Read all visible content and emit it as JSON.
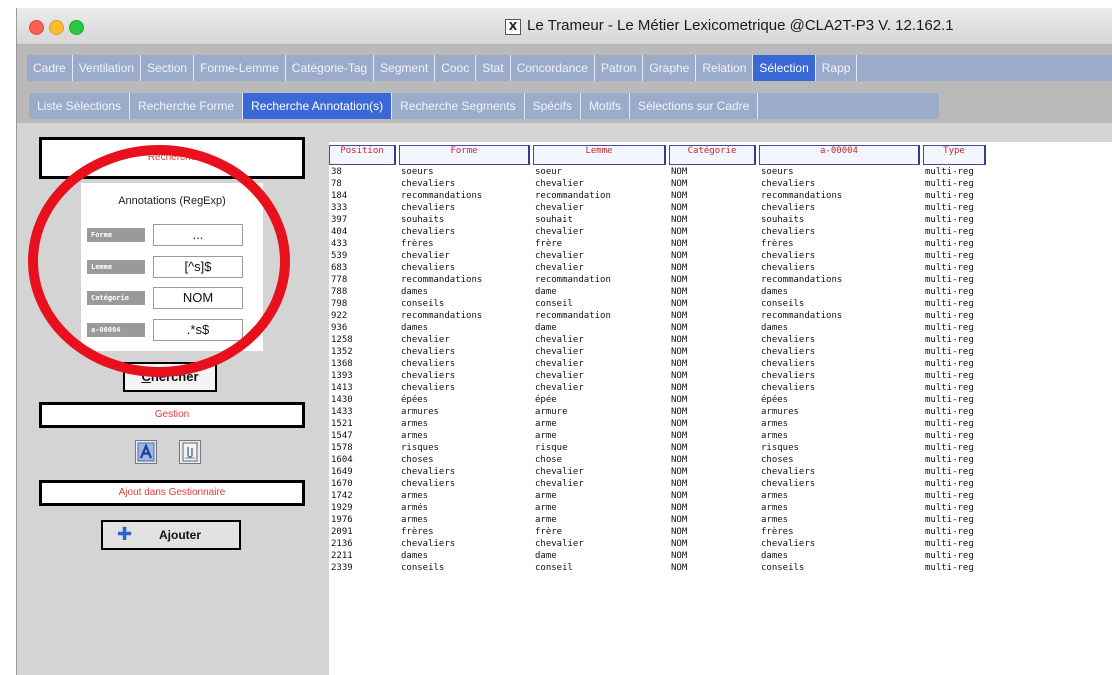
{
  "window": {
    "title_glyph": "X",
    "title": "Le Trameur - Le Métier Lexicometrique @CLA2T-P3 V. 12.162.1"
  },
  "main_tabs": [
    {
      "label": "Cadre"
    },
    {
      "label": "Ventilation"
    },
    {
      "label": "Section"
    },
    {
      "label": "Forme-Lemme"
    },
    {
      "label": "Catégorie-Tag"
    },
    {
      "label": "Segment"
    },
    {
      "label": "Cooc"
    },
    {
      "label": "Stat"
    },
    {
      "label": "Concordance"
    },
    {
      "label": "Patron"
    },
    {
      "label": "Graphe"
    },
    {
      "label": "Relation"
    },
    {
      "label": "Sélection",
      "active": true
    },
    {
      "label": "Rapp"
    }
  ],
  "sub_tabs": [
    {
      "label": "Liste Sélections"
    },
    {
      "label": "Recherche Forme"
    },
    {
      "label": "Recherche Annotation(s)",
      "active": true
    },
    {
      "label": "Recherche Segments"
    },
    {
      "label": "Spécifs"
    },
    {
      "label": "Motifs"
    },
    {
      "label": "Sélections sur Cadre"
    }
  ],
  "left_panel": {
    "recherche_title": "Recherche",
    "annotations_title": "Annotations (RegExp)",
    "fields": [
      {
        "label": "Forme",
        "value": "..."
      },
      {
        "label": "Lemme",
        "value": "[^s]$"
      },
      {
        "label": "Catégorie",
        "value": "NOM"
      },
      {
        "label": "a-00004",
        "value": ".*s$"
      }
    ],
    "chercher_accel": "C",
    "chercher_rest": "hercher",
    "gestion_title": "Gestion",
    "ajout_title": "Ajout dans Gestionnaire",
    "ajouter_label": "Ajouter"
  },
  "table": {
    "columns": [
      "Position",
      "Forme",
      "Lemme",
      "Catégorie",
      "a-00004",
      "Type",
      ""
    ],
    "rows": [
      [
        "38",
        "soeurs",
        "soeur",
        "NOM",
        "soeurs",
        "multi-reg"
      ],
      [
        "78",
        "chevaliers",
        "chevalier",
        "NOM",
        "chevaliers",
        "multi-reg"
      ],
      [
        "184",
        "recommandations",
        "recommandation",
        "NOM",
        "recommandations",
        "multi-reg"
      ],
      [
        "333",
        "chevaliers",
        "chevalier",
        "NOM",
        "chevaliers",
        "multi-reg"
      ],
      [
        "397",
        "souhaits",
        "souhait",
        "NOM",
        "souhaits",
        "multi-reg"
      ],
      [
        "404",
        "chevaliers",
        "chevalier",
        "NOM",
        "chevaliers",
        "multi-reg"
      ],
      [
        "433",
        "frères",
        "frère",
        "NOM",
        "frères",
        "multi-reg"
      ],
      [
        "539",
        "chevalier",
        "chevalier",
        "NOM",
        "chevaliers",
        "multi-reg"
      ],
      [
        "683",
        "chevaliers",
        "chevalier",
        "NOM",
        "chevaliers",
        "multi-reg"
      ],
      [
        "778",
        "recommandations",
        "recommandation",
        "NOM",
        "recommandations",
        "multi-reg"
      ],
      [
        "788",
        "dames",
        "dame",
        "NOM",
        "dames",
        "multi-reg"
      ],
      [
        "798",
        "conseils",
        "conseil",
        "NOM",
        "conseils",
        "multi-reg"
      ],
      [
        "922",
        "recommandations",
        "recommandation",
        "NOM",
        "recommandations",
        "multi-reg"
      ],
      [
        "936",
        "dames",
        "dame",
        "NOM",
        "dames",
        "multi-reg"
      ],
      [
        "1258",
        "chevalier",
        "chevalier",
        "NOM",
        "chevaliers",
        "multi-reg"
      ],
      [
        "1352",
        "chevaliers",
        "chevalier",
        "NOM",
        "chevaliers",
        "multi-reg"
      ],
      [
        "1368",
        "chevaliers",
        "chevalier",
        "NOM",
        "chevaliers",
        "multi-reg"
      ],
      [
        "1393",
        "chevaliers",
        "chevalier",
        "NOM",
        "chevaliers",
        "multi-reg"
      ],
      [
        "1413",
        "chevaliers",
        "chevalier",
        "NOM",
        "chevaliers",
        "multi-reg"
      ],
      [
        "1430",
        "épées",
        "épée",
        "NOM",
        "épées",
        "multi-reg"
      ],
      [
        "1433",
        "armures",
        "armure",
        "NOM",
        "armures",
        "multi-reg"
      ],
      [
        "1521",
        "armes",
        "arme",
        "NOM",
        "armes",
        "multi-reg"
      ],
      [
        "1547",
        "armes",
        "arme",
        "NOM",
        "armes",
        "multi-reg"
      ],
      [
        "1578",
        "risques",
        "risque",
        "NOM",
        "risques",
        "multi-reg"
      ],
      [
        "1604",
        "choses",
        "chose",
        "NOM",
        "choses",
        "multi-reg"
      ],
      [
        "1649",
        "chevaliers",
        "chevalier",
        "NOM",
        "chevaliers",
        "multi-reg"
      ],
      [
        "1670",
        "chevaliers",
        "chevalier",
        "NOM",
        "chevaliers",
        "multi-reg"
      ],
      [
        "1742",
        "armes",
        "arme",
        "NOM",
        "armes",
        "multi-reg"
      ],
      [
        "1929",
        "armés",
        "arme",
        "NOM",
        "armes",
        "multi-reg"
      ],
      [
        "1976",
        "armes",
        "arme",
        "NOM",
        "armes",
        "multi-reg"
      ],
      [
        "2091",
        "frères",
        "frère",
        "NOM",
        "frères",
        "multi-reg"
      ],
      [
        "2136",
        "chevaliers",
        "chevalier",
        "NOM",
        "chevaliers",
        "multi-reg"
      ],
      [
        "2211",
        "dames",
        "dame",
        "NOM",
        "dames",
        "multi-reg"
      ],
      [
        "2339",
        "conseils",
        "conseil",
        "NOM",
        "conseils",
        "multi-reg"
      ]
    ]
  },
  "colors": {
    "active_tab": "#3a68d6",
    "inactive_tab": "#9baccb",
    "header_text": "#c8272b",
    "highlight_ring": "#e8101d"
  },
  "icons": [
    "text-a-icon",
    "document-clip-icon",
    "plus-icon"
  ]
}
